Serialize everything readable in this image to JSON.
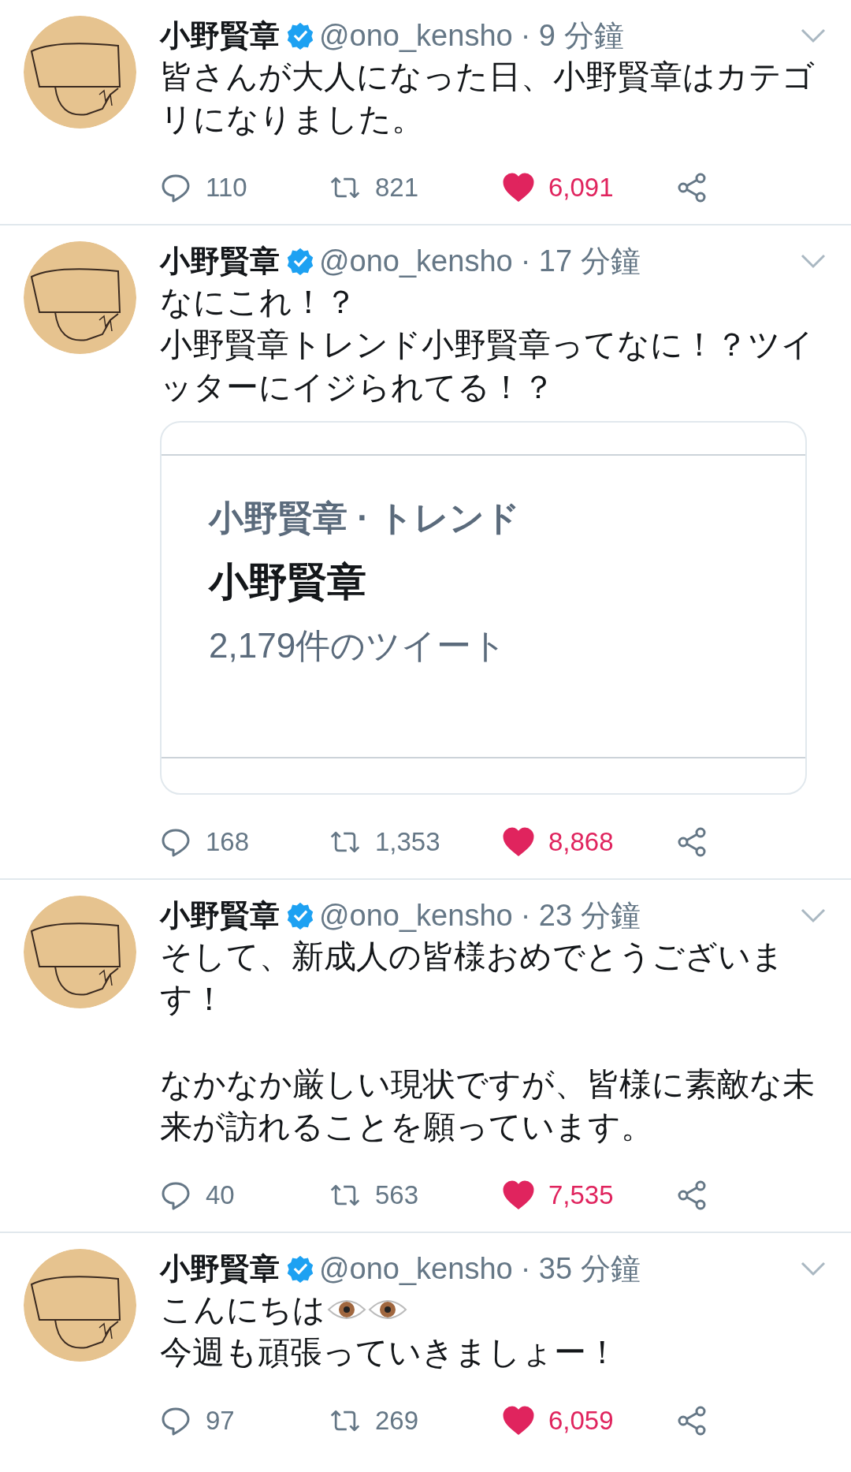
{
  "tweets": [
    {
      "name": "小野賢章",
      "verified": true,
      "handle": "@ono_kensho",
      "time": "· 9 分鐘",
      "paragraphs": [
        {
          "lines": [
            {
              "text": "皆さんが大人になった日、小野賢章はカテゴリになりました。"
            }
          ]
        }
      ],
      "replies": "110",
      "retweets": "821",
      "likes": "6,091",
      "liked": true
    },
    {
      "name": "小野賢章",
      "verified": true,
      "handle": "@ono_kensho",
      "time": "· 17 分鐘",
      "paragraphs": [
        {
          "lines": [
            {
              "text": "なにこれ！？"
            },
            {
              "text": "小野賢章トレンド小野賢章ってなに！？ツイッターにイジられてる！？"
            }
          ]
        }
      ],
      "card": {
        "trend_label": "小野賢章 · トレンド",
        "trend_name": "小野賢章",
        "tweet_count": "2,179件のツイート"
      },
      "replies": "168",
      "retweets": "1,353",
      "likes": "8,868",
      "liked": true
    },
    {
      "name": "小野賢章",
      "verified": true,
      "handle": "@ono_kensho",
      "time": "· 23 分鐘",
      "paragraphs": [
        {
          "lines": [
            {
              "text": "そして、新成人の皆様おめでとうございます！"
            }
          ]
        },
        {
          "lines": [
            {
              "text": "なかなか厳しい現状ですが、皆様に素敵な未来が訪れることを願っています。"
            }
          ]
        }
      ],
      "replies": "40",
      "retweets": "563",
      "likes": "7,535",
      "liked": true
    },
    {
      "name": "小野賢章",
      "verified": true,
      "handle": "@ono_kensho",
      "time": "· 35 分鐘",
      "paragraphs": [
        {
          "lines": [
            {
              "text": "こんにちは",
              "icons": [
                {
                  "kind": "eye"
                },
                {
                  "kind": "eye"
                }
              ]
            },
            {
              "text": "今週も頑張っていきましょー！"
            }
          ]
        }
      ],
      "replies": "97",
      "retweets": "269",
      "likes": "6,059",
      "liked": true
    }
  ]
}
